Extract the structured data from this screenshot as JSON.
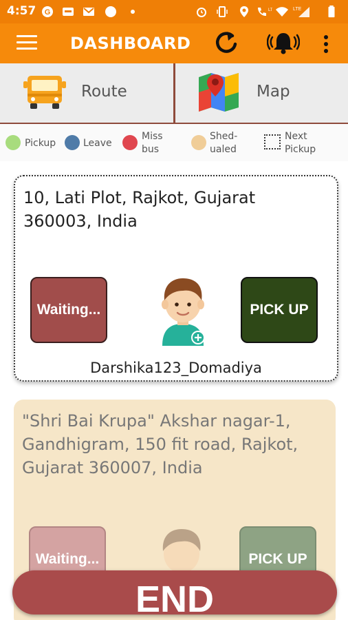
{
  "status_bar": {
    "time": "4:57",
    "icons": [
      "google-icon",
      "news-icon",
      "gmail-icon",
      "circle-icon",
      "dot-icon",
      "alarm-icon",
      "vibrate-icon",
      "location-icon",
      "volte-call-icon",
      "wifi-icon",
      "signal-icon",
      "battery-icon"
    ]
  },
  "app_bar": {
    "title": "DASHBOARD",
    "icons": [
      "menu-icon",
      "refresh-icon",
      "alarm-bell-icon",
      "more-vert-icon"
    ]
  },
  "tabs": [
    {
      "label": "Route",
      "icon": "bus-icon"
    },
    {
      "label": "Map",
      "icon": "map-icon"
    }
  ],
  "legend": [
    {
      "label": "Pickup",
      "color": "#a8dc7d"
    },
    {
      "label": "Leave",
      "color": "#4f7ba8"
    },
    {
      "label_line1": "Miss",
      "label_line2": "bus",
      "color": "#e0474f"
    },
    {
      "label_line1": "Shed-",
      "label_line2": "ualed",
      "color": "#f0cd98"
    },
    {
      "label_line1": "Next",
      "label_line2": "Pickup",
      "color": "dotted-border"
    }
  ],
  "stops": [
    {
      "address": "10, Lati Plot, Rajkot, Gujarat 360003, India",
      "status_button": "Waiting...",
      "action_button": "PICK UP",
      "username": "Darshika123_Domadiya",
      "state": "next-pickup"
    },
    {
      "address": "\"Shri Bai Krupa\" Akshar nagar-1, Gandhigram, 150 fit road, Rajkot, Gujarat 360007, India",
      "status_button": "Waiting...",
      "action_button": "PICK UP",
      "state": "sheduled"
    }
  ],
  "end_button": "END",
  "colors": {
    "primary": "#f68a0b",
    "status_bar": "#ef7f06",
    "accent_dark_red": "#8e4a3b",
    "waiting": "#a14d4b",
    "pickup": "#2e4817",
    "end": "#a94b4b"
  }
}
